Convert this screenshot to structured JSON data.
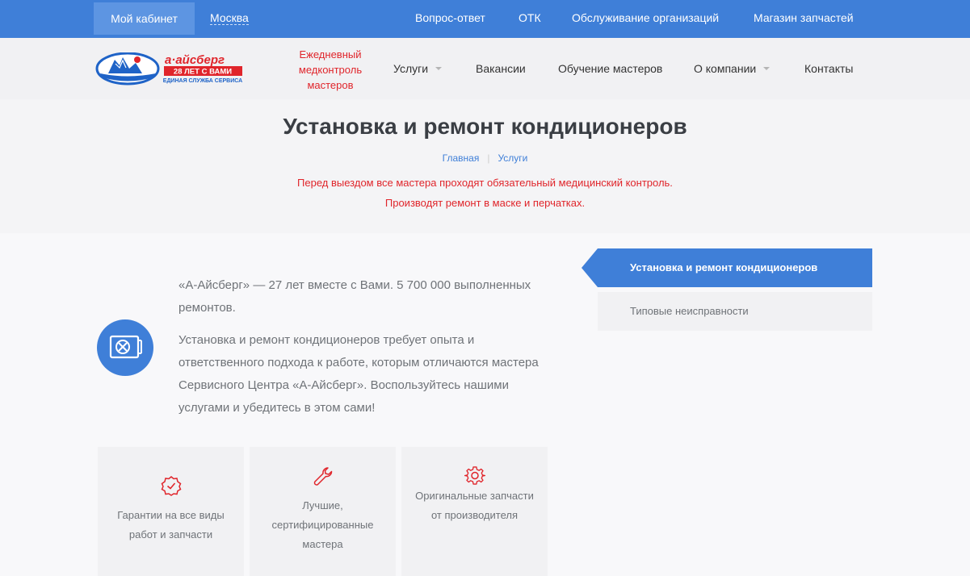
{
  "topbar": {
    "cabinet": "Мой кабинет",
    "city": "Москва",
    "links": [
      "Вопрос-ответ",
      "ОТК",
      "Обслуживание организаций",
      "Магазин запчастей"
    ]
  },
  "header": {
    "logo": {
      "brand": "а·айсберг",
      "years": "28 ЛЕТ С ВАМИ",
      "tagline": "ЕДИНАЯ СЛУЖБА СЕРВИСА"
    },
    "promo": [
      "Ежедневный",
      "медконтроль",
      "мастеров"
    ],
    "nav": [
      "Услуги",
      "Вакансии",
      "Обучение мастеров",
      "О компании",
      "Контакты"
    ]
  },
  "hero": {
    "title": "Установка и ремонт кондиционеров",
    "breadcrumbs": [
      "Главная",
      "Услуги"
    ],
    "notices": [
      "Перед выездом все мастера проходят обязательный медицинский контроль.",
      "Производят ремонт в маске и перчатках."
    ]
  },
  "main": {
    "paragraphs": [
      "«А-Айсберг» — 27 лет вместе с Вами. 5 700 000 выполненных ремонтов.",
      "Установка и ремонт кондиционеров требует опыта и ответственного подхода к работе, которым отличаются мастера Сервисного Центра «А-Айсберг». Воспользуйтесь нашими услугами и убедитесь в этом сами!"
    ],
    "features": [
      {
        "icon": "badge-check-icon",
        "text": "Гарантии на все виды работ и запчасти"
      },
      {
        "icon": "wrench-icon",
        "text": "Лучшие, сертифицированные мастера"
      },
      {
        "icon": "gear-icon",
        "text": "Оригинальные запчасти от производителя"
      }
    ]
  },
  "sidebar": {
    "items": [
      {
        "label": "Установка и ремонт кондиционеров",
        "active": true
      },
      {
        "label": "Типовые неисправности",
        "active": false
      }
    ]
  },
  "colors": {
    "accent": "#3f7fd8",
    "alert": "#e0252b",
    "muted_text": "#6f7378"
  }
}
